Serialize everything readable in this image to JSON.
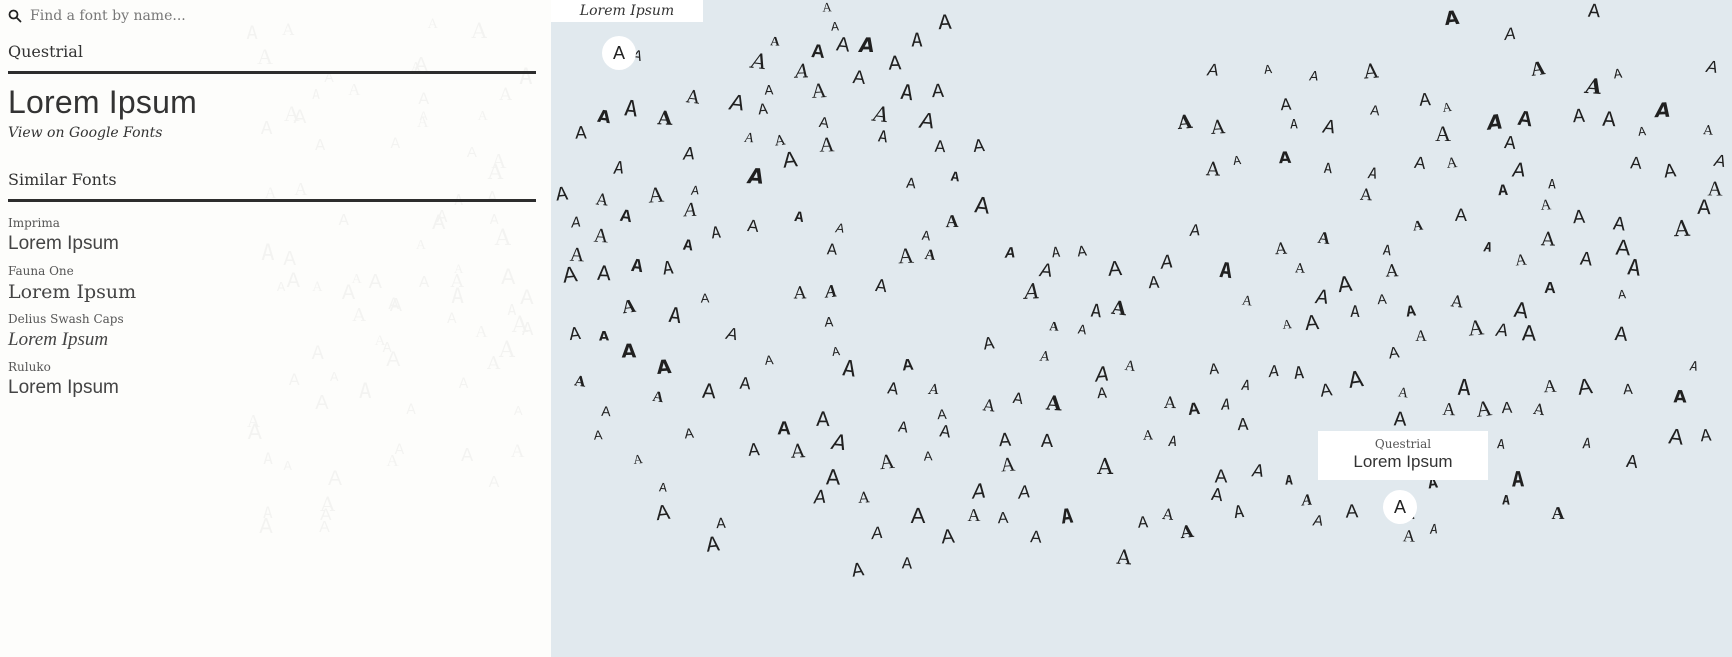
{
  "search": {
    "placeholder": "Find a font by name...",
    "icon": "search-icon"
  },
  "featured_font": {
    "name": "Questrial",
    "sample_text": "Lorem Ipsum",
    "link_label": "View on Google Fonts"
  },
  "similar_fonts": {
    "title": "Similar Fonts",
    "items": [
      {
        "name": "Imprima",
        "sample_text": "Lorem Ipsum"
      },
      {
        "name": "Fauna One",
        "sample_text": "Lorem Ipsum"
      },
      {
        "name": "Delius Swash Caps",
        "sample_text": "Lorem Ipsum"
      },
      {
        "name": "Ruluko",
        "sample_text": "Lorem Ipsum"
      }
    ]
  },
  "map": {
    "top_chip_text": "Lorem Ipsum",
    "left_circle_glyph": "A",
    "right_circle_glyph": "A",
    "tooltip": {
      "font_name": "Questrial",
      "sample_text": "Lorem Ipsum"
    },
    "glyph": "A"
  },
  "colors": {
    "sidebar_background": "#fdfdfb",
    "map_background": "#e1e9ee",
    "text": "#333333",
    "rule": "#2d2d2d",
    "glyph": "#202020",
    "highlight": "#ffffff"
  }
}
